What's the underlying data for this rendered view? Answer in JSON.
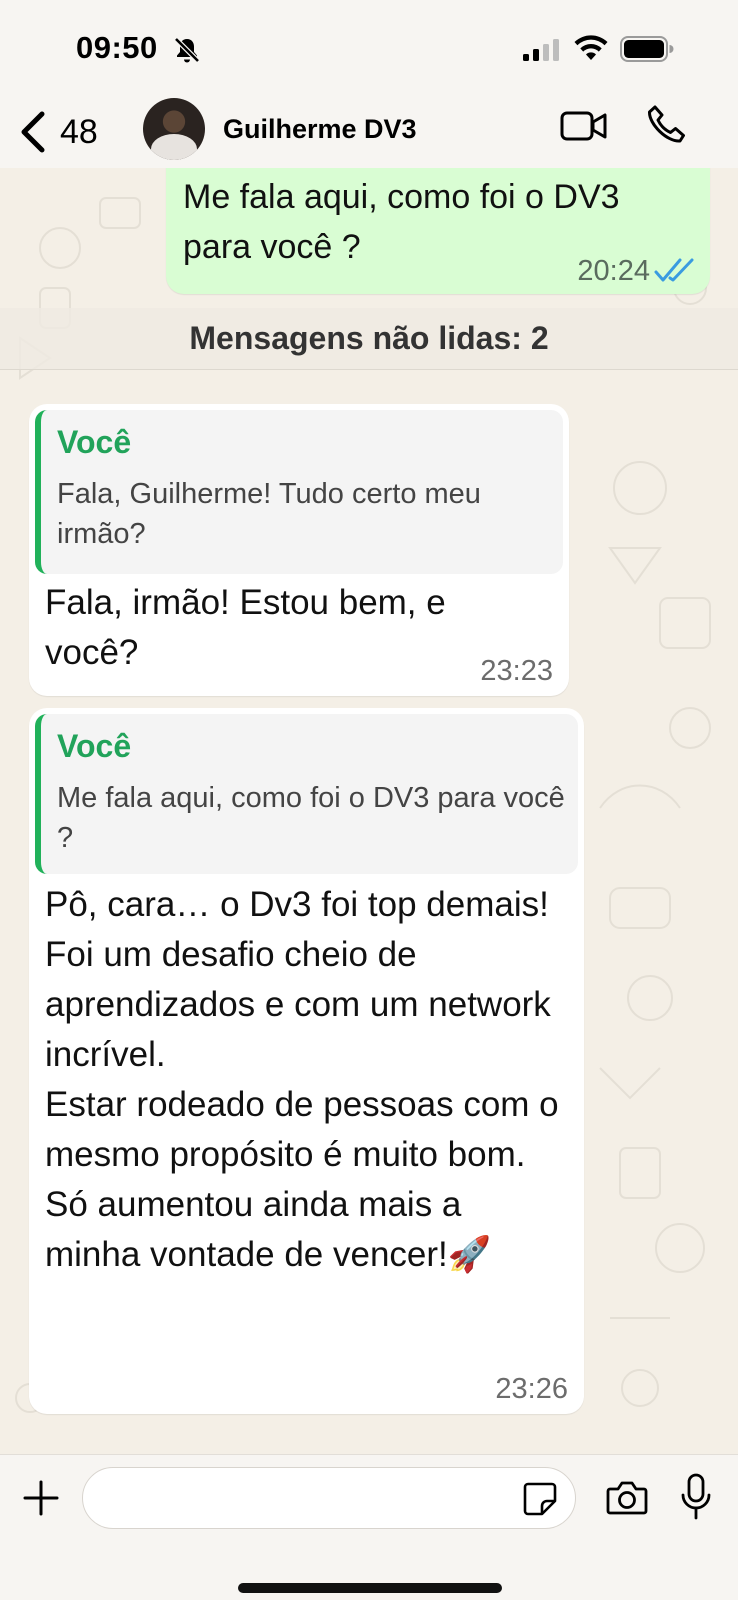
{
  "status_bar": {
    "time": "09:50"
  },
  "header": {
    "back_count": "48",
    "contact_name": "Guilherme DV3"
  },
  "messages": [
    {
      "direction": "outgoing",
      "text": "Me fala aqui, como foi o DV3 para você ?",
      "time": "20:24",
      "status": "read"
    },
    {
      "direction": "incoming",
      "quote": {
        "author": "Você",
        "text": "Fala, Guilherme! Tudo certo meu irmão?"
      },
      "text": "Fala, irmão! Estou bem, e você?",
      "time": "23:23"
    },
    {
      "direction": "incoming",
      "quote": {
        "author": "Você",
        "text": "Me fala aqui, como foi o DV3 para você ?"
      },
      "text": "Pô, cara… o Dv3 foi top demais!\nFoi um desafio cheio de aprendizados e com um network incrível.\nEstar rodeado de pessoas com o mesmo propósito é muito bom.\nSó aumentou ainda mais a minha vontade de vencer!🚀",
      "time": "23:26"
    }
  ],
  "unread_divider": "Mensagens não lidas: 2",
  "composer": {
    "value": "",
    "placeholder": ""
  },
  "colors": {
    "outgoing_bubble": "#d9fdd3",
    "quote_accent": "#21b15a",
    "read_ticks": "#3a9be0"
  },
  "icons": [
    "bell-off-icon",
    "signal-icon",
    "wifi-icon",
    "battery-icon",
    "chevron-left-icon",
    "video-call-icon",
    "phone-icon",
    "double-check-icon",
    "plus-icon",
    "sticker-icon",
    "camera-icon",
    "microphone-icon"
  ]
}
